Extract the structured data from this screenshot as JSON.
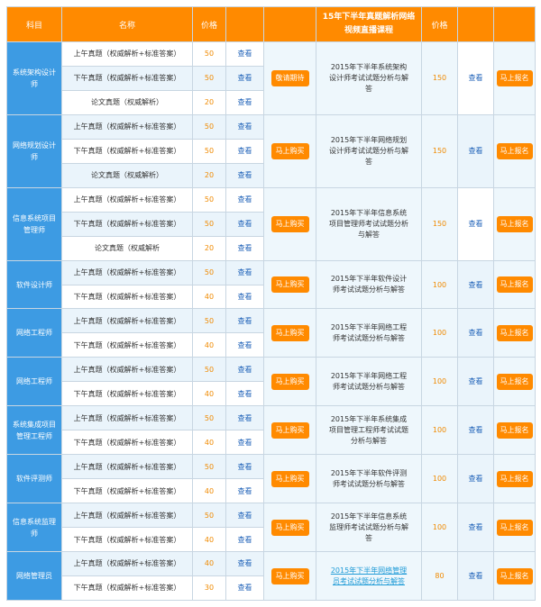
{
  "header": {
    "subject": "科目",
    "name": "名称",
    "price": "价格",
    "action": "",
    "course": "15年下半年真题解析网络视频直播课程",
    "course_price": "价格",
    "course_view": "",
    "course_action": ""
  },
  "groups": [
    {
      "subject": "系统架构设计师",
      "papers": [
        {
          "name": "上午真题（权威解析+标准答案）",
          "price": "50",
          "view": "查看"
        },
        {
          "name": "下午真题（权威解析+标准答案）",
          "price": "50",
          "view": "查看"
        },
        {
          "name": "论文真题（权威解析）",
          "price": "20",
          "view": "查看"
        }
      ],
      "buy": "敬请期待",
      "course": "2015年下半年系统架构设计师考试试题分析与解答",
      "course_price": "150",
      "course_view": "查看",
      "signup": "马上报名",
      "course_link": false
    },
    {
      "subject": "网络规划设计师",
      "papers": [
        {
          "name": "上午真题（权威解析+标准答案）",
          "price": "50",
          "view": "查看"
        },
        {
          "name": "下午真题（权威解析+标准答案）",
          "price": "50",
          "view": "查看"
        },
        {
          "name": "论文真题（权威解析）",
          "price": "20",
          "view": "查看"
        }
      ],
      "buy": "马上购买",
      "course": "2015年下半年网络规划设计师考试试题分析与解答",
      "course_price": "150",
      "course_view": "查看",
      "signup": "马上报名",
      "course_link": false
    },
    {
      "subject": "信息系统项目管理师",
      "papers": [
        {
          "name": "上午真题（权威解析+标准答案）",
          "price": "50",
          "view": "查看"
        },
        {
          "name": "下午真题（权威解析+标准答案）",
          "price": "50",
          "view": "查看"
        },
        {
          "name": "论文真题（权威解析",
          "price": "20",
          "view": "查看"
        }
      ],
      "buy": "马上购买",
      "course": "2015年下半年信息系统项目管理师考试试题分析与解答",
      "course_price": "150",
      "course_view": "查看",
      "signup": "马上报名",
      "course_link": false
    },
    {
      "subject": "软件设计师",
      "papers": [
        {
          "name": "上午真题（权威解析+标准答案）",
          "price": "50",
          "view": "查看"
        },
        {
          "name": "下午真题（权威解析+标准答案）",
          "price": "40",
          "view": "查看"
        }
      ],
      "buy": "马上购买",
      "course": "2015年下半年软件设计师考试试题分析与解答",
      "course_price": "100",
      "course_view": "查看",
      "signup": "马上报名",
      "course_link": false
    },
    {
      "subject": "网络工程师",
      "papers": [
        {
          "name": "上午真题（权威解析+标准答案）",
          "price": "50",
          "view": "查看"
        },
        {
          "name": "下午真题（权威解析+标准答案）",
          "price": "40",
          "view": "查看"
        }
      ],
      "buy": "马上购买",
      "course": "2015年下半年网络工程师考试试题分析与解答",
      "course_price": "100",
      "course_view": "查看",
      "signup": "马上报名",
      "course_link": false
    },
    {
      "subject": "网络工程师",
      "papers": [
        {
          "name": "上午真题（权威解析+标准答案）",
          "price": "50",
          "view": "查看"
        },
        {
          "name": "下午真题（权威解析+标准答案）",
          "price": "40",
          "view": "查看"
        }
      ],
      "buy": "马上购买",
      "course": "2015年下半年网络工程师考试试题分析与解答",
      "course_price": "100",
      "course_view": "查看",
      "signup": "马上报名",
      "course_link": false
    },
    {
      "subject": "系统集成项目管理工程师",
      "papers": [
        {
          "name": "上午真题（权威解析+标准答案）",
          "price": "50",
          "view": "查看"
        },
        {
          "name": "下午真题（权威解析+标准答案）",
          "price": "40",
          "view": "查看"
        }
      ],
      "buy": "马上购买",
      "course": "2015年下半年系统集成项目管理工程师考试试题分析与解答",
      "course_price": "100",
      "course_view": "查看",
      "signup": "马上报名",
      "course_link": false
    },
    {
      "subject": "软件评测师",
      "papers": [
        {
          "name": "上午真题（权威解析+标准答案）",
          "price": "50",
          "view": "查看"
        },
        {
          "name": "下午真题（权威解析+标准答案）",
          "price": "40",
          "view": "查看"
        }
      ],
      "buy": "马上购买",
      "course": "2015年下半年软件评测师考试试题分析与解答",
      "course_price": "100",
      "course_view": "查看",
      "signup": "马上报名",
      "course_link": false
    },
    {
      "subject": "信息系统监理师",
      "papers": [
        {
          "name": "上午真题（权威解析+标准答案）",
          "price": "50",
          "view": "查看"
        },
        {
          "name": "下午真题（权威解析+标准答案）",
          "price": "40",
          "view": "查看"
        }
      ],
      "buy": "马上购买",
      "course": "2015年下半年信息系统监理师考试试题分析与解答",
      "course_price": "100",
      "course_view": "查看",
      "signup": "马上报名",
      "course_link": false
    },
    {
      "subject": "网络管理员",
      "papers": [
        {
          "name": "上午真题（权威解析+标准答案）",
          "price": "40",
          "view": "查看"
        },
        {
          "name": "下午真题（权威解析+标准答案）",
          "price": "30",
          "view": "查看"
        }
      ],
      "buy": "马上购买",
      "course": "2015年下半年网络管理员考试试题分析与解答",
      "course_price": "80",
      "course_view": "查看",
      "signup": "马上报名",
      "course_link": true
    }
  ],
  "colors": {
    "header_bg": "#ff8a00",
    "subject_bg": "#3d9be3",
    "price": "#f08a00",
    "link": "#1f62b8",
    "row_alt": "#eaf4fb"
  }
}
